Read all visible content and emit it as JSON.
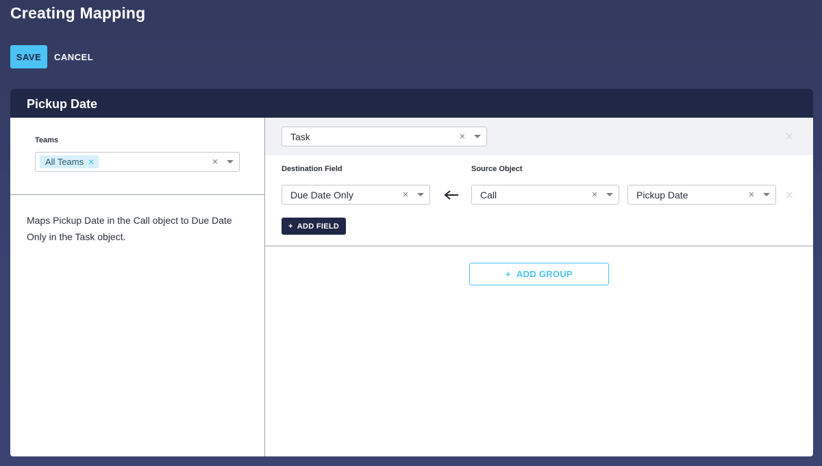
{
  "page": {
    "title": "Creating Mapping"
  },
  "toolbar": {
    "save_label": "SAVE",
    "cancel_label": "CANCEL"
  },
  "card": {
    "title": "Pickup Date"
  },
  "teams": {
    "label": "Teams",
    "chip": "All Teams"
  },
  "description": "Maps Pickup Date in the Call object to Due Date Only in the Task object.",
  "group": {
    "object": "Task",
    "destination_label": "Destination Field",
    "source_label": "Source Object",
    "destination_field": "Due Date Only",
    "source_object": "Call",
    "source_field": "Pickup Date",
    "add_field_label": "ADD FIELD"
  },
  "add_group_label": "ADD GROUP",
  "icons": {
    "clear": "close-icon",
    "dropdown": "chevron-down-icon",
    "arrow": "arrow-left-icon",
    "plus": "plus-icon",
    "remove": "close-icon"
  },
  "colors": {
    "background": "#343c66",
    "accent": "#4cc3f5",
    "header": "#1f2846",
    "chip_bg": "#d7f0fb"
  }
}
